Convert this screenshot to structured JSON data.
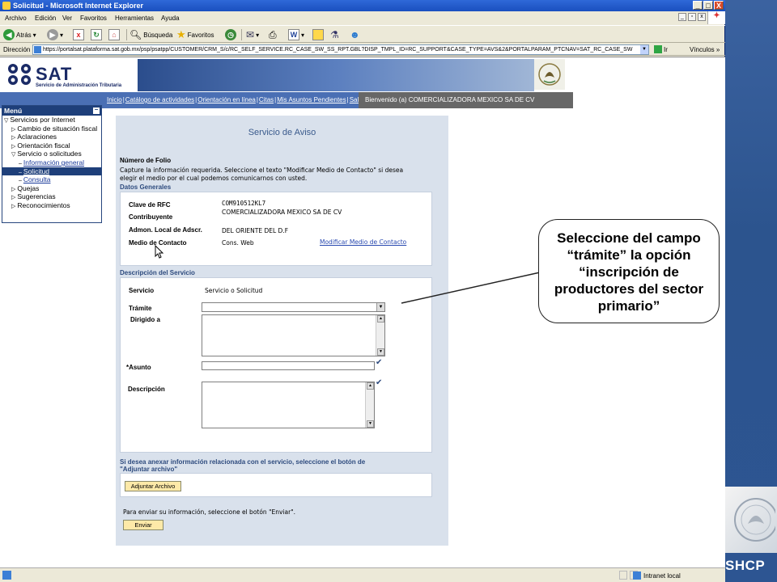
{
  "window": {
    "title": "Solicitud - Microsoft Internet Explorer",
    "buttons": [
      "_",
      "□",
      "X"
    ]
  },
  "menubar": {
    "items": [
      "Archivo",
      "Edición",
      "Ver",
      "Favoritos",
      "Herramientas",
      "Ayuda"
    ]
  },
  "toolbar": {
    "back": "Atrás",
    "search": "Búsqueda",
    "favorites": "Favoritos"
  },
  "address": {
    "label": "Dirección",
    "url": "https://portalsat.plataforma.sat.gob.mx/psp/psatpp/CUSTOMER/CRM_S/c/RC_SELF_SERVICE.RC_CASE_SW_SS_RPT.GBL?DISP_TMPL_ID=RC_SUPPORT&CASE_TYPE=AVS&2&PORTALPARAM_PTCNAV=SAT_RC_CASE_SW",
    "go": "Ir",
    "links": "Vínculos"
  },
  "header": {
    "brand": "SAT",
    "brand_sub": "Servicio de Administración Tributaria"
  },
  "nav": {
    "links": [
      "Inicio",
      "Catálogo de actividades",
      "Orientación en línea",
      "Citas",
      "Mis Asuntos Pendientes",
      "Salir"
    ],
    "welcome": "Bienvenido (a)  COMERCIALIZADORA MEXICO SA DE CV"
  },
  "menu": {
    "title": "Menú",
    "items": [
      {
        "label": "Servicios por Internet",
        "level": 0,
        "marker": "▽"
      },
      {
        "label": "Cambio de situación fiscal",
        "level": 1,
        "marker": "▷"
      },
      {
        "label": "Aclaraciones",
        "level": 1,
        "marker": "▷"
      },
      {
        "label": "Orientación fiscal",
        "level": 1,
        "marker": "▷"
      },
      {
        "label": "Servicio o solicitudes",
        "level": 1,
        "marker": "▽"
      },
      {
        "label": "Información general",
        "level": 2,
        "marker": "–"
      },
      {
        "label": "Solicitud",
        "level": 2,
        "marker": "–"
      },
      {
        "label": "Consulta",
        "level": 2,
        "marker": "–"
      },
      {
        "label": "Quejas",
        "level": 1,
        "marker": "▷"
      },
      {
        "label": "Sugerencias",
        "level": 1,
        "marker": "▷"
      },
      {
        "label": "Reconocimientos",
        "level": 1,
        "marker": "▷"
      }
    ]
  },
  "form": {
    "title": "Servicio de Aviso",
    "folio_label": "Número de Folio",
    "instructions_1": "Capture la información requerida. Seleccione el texto \"Modificar Medio de Contacto\" si desea",
    "instructions_2": "elegir el medio por el cual podemos comunicarnos con usted.",
    "datos_generales": "Datos Generales",
    "rfc_label": "Clave de RFC",
    "rfc_value": "COM910512KL7",
    "contribuyente_label": "Contribuyente",
    "contribuyente_value": "COMERCIALIZADORA  MEXICO SA DE CV",
    "admon_label": "Admon. Local de Adscr.",
    "admon_value": "DEL ORIENTE DEL D.F",
    "medio_label": "Medio de Contacto",
    "medio_value": "Cons. Web",
    "modificar_link": "Modificar Medio de Contacto",
    "descripcion_servicio": "Descripción del Servicio",
    "servicio_label": "Servicio",
    "servicio_value": "Servicio o Solicitud",
    "tramite_label": "Trámite",
    "tramite_value": "",
    "dirigido_label": "Dirigido a",
    "asunto_label": "*Asunto",
    "descripcion_label": "Descripción",
    "anexar_1": "Si desea anexar información relacionada con el servicio, seleccione el botón de",
    "anexar_2": "\"Adjuntar archivo\"",
    "adjuntar_button": "Adjuntar Archivo",
    "enviar_text": "Para enviar su información, seleccione el botón \"Enviar\".",
    "enviar_button": "Enviar"
  },
  "callout": {
    "text": "Seleccione del campo “trámite” la opción “inscripción de productores del sector primario”"
  },
  "status": {
    "zone": "Intranet local"
  },
  "slide": {
    "agency": "SHCP"
  },
  "colors": {
    "accent": "#1e3f7a",
    "nav": "#4a6fb4",
    "panel": "#d9e1ec",
    "button": "#fde9a8"
  }
}
